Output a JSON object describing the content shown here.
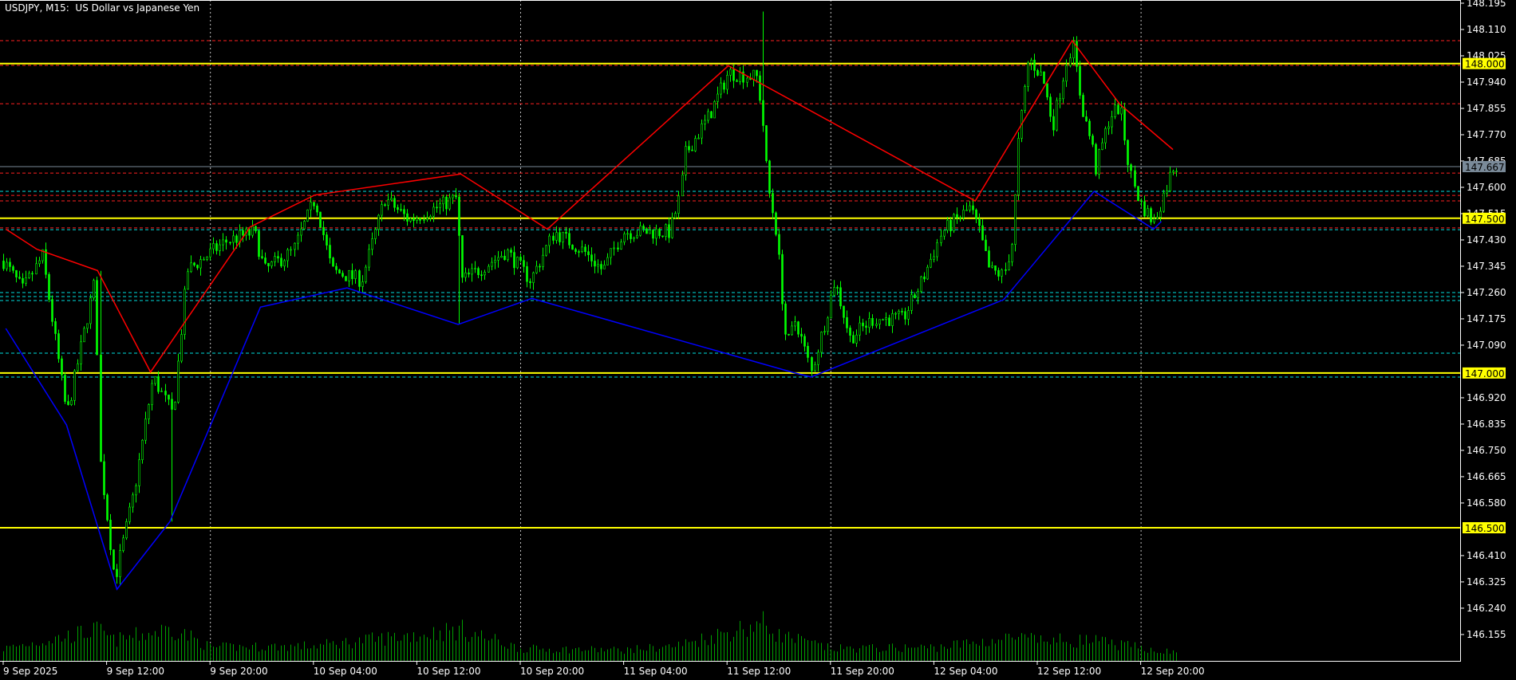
{
  "chart_data": {
    "type": "candlestick",
    "title": "USDJPY, M15:  US Dollar vs Japanese Yen",
    "symbol": "USDJPY",
    "timeframe": "M15",
    "ylim": [
      146.09,
      148.205
    ],
    "y_ticks": [
      "148.195",
      "148.110",
      "148.025",
      "147.940",
      "147.855",
      "147.770",
      "147.685",
      "147.600",
      "147.515",
      "147.430",
      "147.345",
      "147.260",
      "147.175",
      "147.090",
      "146.920",
      "146.835",
      "146.750",
      "146.665",
      "146.580",
      "146.410",
      "146.325",
      "146.240",
      "146.155"
    ],
    "x_ticks": [
      {
        "t": 0,
        "label": "9 Sep 2025"
      },
      {
        "t": 8,
        "label": "9 Sep 12:00"
      },
      {
        "t": 16,
        "label": "9 Sep 20:00"
      },
      {
        "t": 24,
        "label": "10 Sep 04:00"
      },
      {
        "t": 32,
        "label": "10 Sep 12:00"
      },
      {
        "t": 40,
        "label": "10 Sep 20:00"
      },
      {
        "t": 48,
        "label": "11 Sep 04:00"
      },
      {
        "t": 56,
        "label": "11 Sep 12:00"
      },
      {
        "t": 64,
        "label": "11 Sep 20:00"
      },
      {
        "t": 72,
        "label": "12 Sep 04:00"
      },
      {
        "t": 80,
        "label": "12 Sep 12:00"
      },
      {
        "t": 88,
        "label": "12 Sep 20:00"
      }
    ],
    "grid_hours": [
      16,
      40,
      64,
      88
    ],
    "bars_per_hour": 4,
    "total_hours": 90.7,
    "price_path": [
      [
        0,
        147.362
      ],
      [
        1.5,
        147.269
      ],
      [
        3.0,
        147.378
      ],
      [
        4.9,
        146.863
      ],
      [
        7.1,
        147.3
      ],
      [
        7.5,
        146.707
      ],
      [
        8.6,
        146.332
      ],
      [
        10.1,
        146.613
      ],
      [
        11.6,
        146.988
      ],
      [
        13.1,
        146.863
      ],
      [
        14.2,
        147.331
      ],
      [
        17.2,
        147.425
      ],
      [
        19.4,
        147.456
      ],
      [
        20.2,
        147.331
      ],
      [
        22.4,
        147.394
      ],
      [
        24.1,
        147.565
      ],
      [
        25.4,
        147.331
      ],
      [
        27.7,
        147.3
      ],
      [
        29.5,
        147.565
      ],
      [
        31.4,
        147.494
      ],
      [
        35.0,
        147.565
      ],
      [
        35.5,
        147.3
      ],
      [
        36.7,
        147.331
      ],
      [
        38.9,
        147.394
      ],
      [
        40.8,
        147.3
      ],
      [
        42.6,
        147.456
      ],
      [
        44.9,
        147.394
      ],
      [
        46.4,
        147.331
      ],
      [
        47.9,
        147.456
      ],
      [
        51.6,
        147.456
      ],
      [
        52.4,
        147.581
      ],
      [
        52.7,
        147.706
      ],
      [
        54.6,
        147.831
      ],
      [
        56.1,
        147.971
      ],
      [
        58.3,
        147.955
      ],
      [
        58.7,
        147.831
      ],
      [
        59.1,
        147.612
      ],
      [
        59.8,
        147.456
      ],
      [
        60.6,
        147.081
      ],
      [
        61.3,
        147.175
      ],
      [
        62.5,
        147.003
      ],
      [
        63.6,
        147.175
      ],
      [
        64.3,
        147.3
      ],
      [
        65.5,
        147.113
      ],
      [
        67.3,
        147.175
      ],
      [
        69.6,
        147.175
      ],
      [
        71.1,
        147.3
      ],
      [
        72.6,
        147.456
      ],
      [
        74.8,
        147.534
      ],
      [
        75.5,
        147.456
      ],
      [
        76.3,
        147.331
      ],
      [
        77.4,
        147.316
      ],
      [
        78.2,
        147.456
      ],
      [
        78.3,
        147.675
      ],
      [
        79.3,
        148.018
      ],
      [
        80.4,
        147.955
      ],
      [
        81.2,
        147.8
      ],
      [
        82.3,
        148.018
      ],
      [
        82.7,
        148.065
      ],
      [
        83.4,
        147.862
      ],
      [
        84.2,
        147.737
      ],
      [
        84.5,
        147.659
      ],
      [
        85.6,
        147.831
      ],
      [
        86.4,
        147.862
      ],
      [
        87.1,
        147.659
      ],
      [
        87.9,
        147.55
      ],
      [
        89.0,
        147.487
      ],
      [
        89.8,
        147.581
      ],
      [
        90.5,
        147.667
      ]
    ],
    "wick_extremes": [
      [
        35.2,
        "low",
        147.16
      ],
      [
        58.7,
        "high",
        148.168
      ],
      [
        12.9,
        "low",
        146.52
      ],
      [
        7.4,
        "high",
        147.33
      ]
    ],
    "volume_profile": [
      [
        0,
        18
      ],
      [
        7.3,
        45
      ],
      [
        8.5,
        30
      ],
      [
        13.1,
        48
      ],
      [
        16,
        20
      ],
      [
        24,
        22
      ],
      [
        35.4,
        46
      ],
      [
        40,
        18
      ],
      [
        48,
        16
      ],
      [
        52,
        22
      ],
      [
        58.7,
        56
      ],
      [
        60,
        38
      ],
      [
        64,
        18
      ],
      [
        72,
        20
      ],
      [
        78.2,
        34
      ],
      [
        80,
        30
      ],
      [
        84,
        30
      ],
      [
        90.7,
        12
      ]
    ],
    "zigzag_highs": [
      [
        0.2,
        147.465
      ],
      [
        2.6,
        147.4
      ],
      [
        7.3,
        147.331
      ],
      [
        11.4,
        147.003
      ],
      [
        19.1,
        147.472
      ],
      [
        24.1,
        147.575
      ],
      [
        35.4,
        147.643
      ],
      [
        42.1,
        147.465
      ],
      [
        56.1,
        147.993
      ],
      [
        75.2,
        147.556
      ],
      [
        82.7,
        148.074
      ],
      [
        86.4,
        147.868
      ],
      [
        90.5,
        147.722
      ]
    ],
    "zigzag_lows": [
      [
        0.2,
        147.144
      ],
      [
        4.9,
        146.832
      ],
      [
        8.8,
        146.301
      ],
      [
        12.9,
        146.52
      ],
      [
        19.9,
        147.213
      ],
      [
        26.6,
        147.275
      ],
      [
        35.2,
        147.157
      ],
      [
        40.9,
        147.241
      ],
      [
        61.0,
        147.003
      ],
      [
        62.5,
        146.987
      ],
      [
        77.4,
        147.237
      ],
      [
        84.4,
        147.587
      ],
      [
        89.0,
        147.465
      ],
      [
        89.6,
        147.49
      ]
    ],
    "levels_yellow": [
      {
        "price": 148.0,
        "label": "148.000"
      },
      {
        "price": 147.5,
        "label": "147.500"
      },
      {
        "price": 147.0,
        "label": "147.000"
      },
      {
        "price": 146.5,
        "label": "146.500"
      }
    ],
    "levels_red_dashed": [
      148.074,
      147.994,
      147.87,
      147.646,
      147.574,
      147.556,
      147.469
    ],
    "levels_cyan_dashed": [
      147.587,
      147.463,
      147.26,
      147.247,
      147.234,
      147.064,
      146.987
    ],
    "current_price": {
      "price": 147.667,
      "label": "147.667"
    },
    "colors": {
      "background": "#000000",
      "candle": "#00ff00",
      "volume": "#00a000",
      "zigzag_high": "#ff0000",
      "zigzag_low": "#0000ff",
      "level": "#ffff00",
      "red_level": "#ff2020",
      "cyan_level": "#00e0e0",
      "current": "#7a8a99",
      "grid": "#c0c0c0",
      "axis": "#ffffff"
    }
  }
}
